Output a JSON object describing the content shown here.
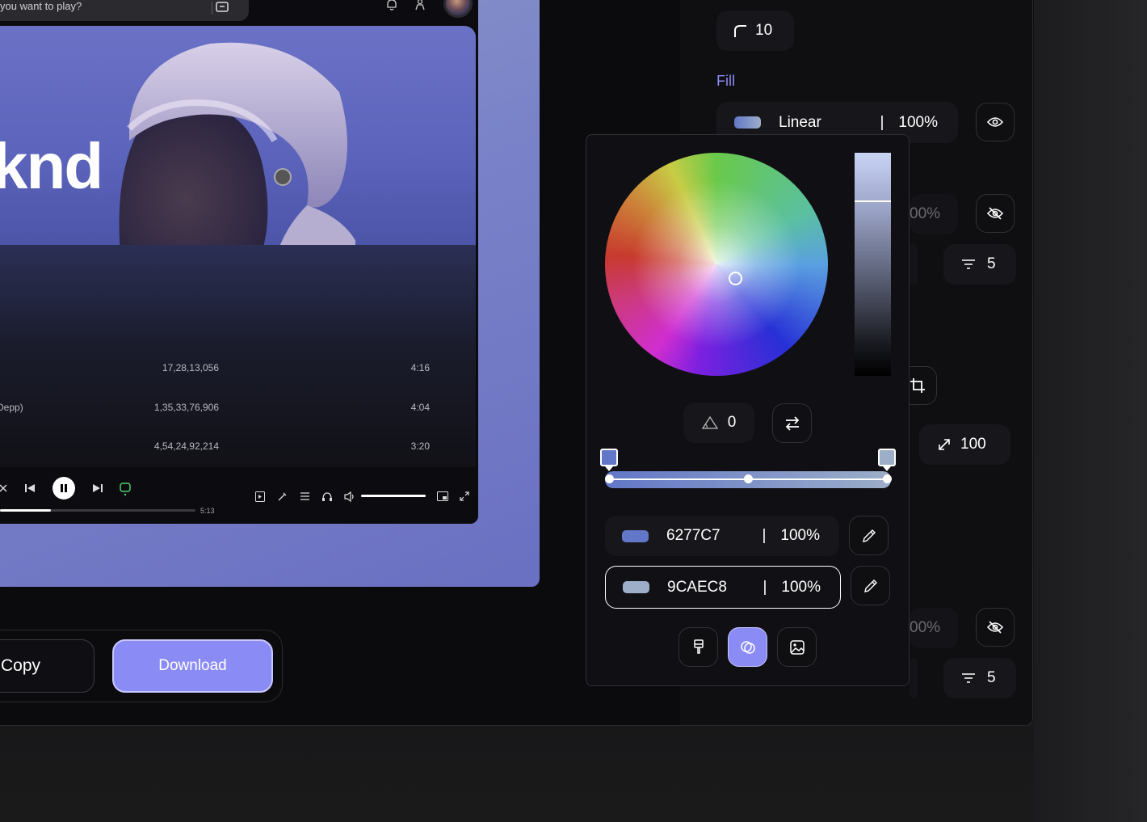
{
  "search": {
    "placeholder": "you want to play?"
  },
  "hero": {
    "title": "knd"
  },
  "tracks": [
    {
      "name": "",
      "plays": "17,28,13,056",
      "duration": "4:16"
    },
    {
      "name": "Depp)",
      "plays": "1,35,33,76,906",
      "duration": "4:04"
    },
    {
      "name": "",
      "plays": "4,54,24,92,214",
      "duration": "3:20"
    }
  ],
  "player": {
    "total_time": "5:13",
    "progress": 0.26,
    "volume": 1.0
  },
  "actions": {
    "copy_label": "Copy",
    "download_label": "Download"
  },
  "panel": {
    "radius_value": "10",
    "fill_label": "Fill",
    "fill_type": "Linear",
    "fill_opacity": "100%",
    "layer2_opacity": "00%",
    "blur_value_1": "5",
    "scale_value": "100",
    "layer3_opacity": "00%",
    "blur_value_2": "5"
  },
  "picker": {
    "angle": "0",
    "stops": [
      {
        "hex": "6277C7",
        "opacity": "100%",
        "color": "#6277C7"
      },
      {
        "hex": "9CAEC8",
        "opacity": "100%",
        "color": "#9CAEC8"
      }
    ],
    "active_mode": "gradient"
  },
  "colors": {
    "accent": "#8B8BF5",
    "fill_label": "#8D8CF3"
  }
}
